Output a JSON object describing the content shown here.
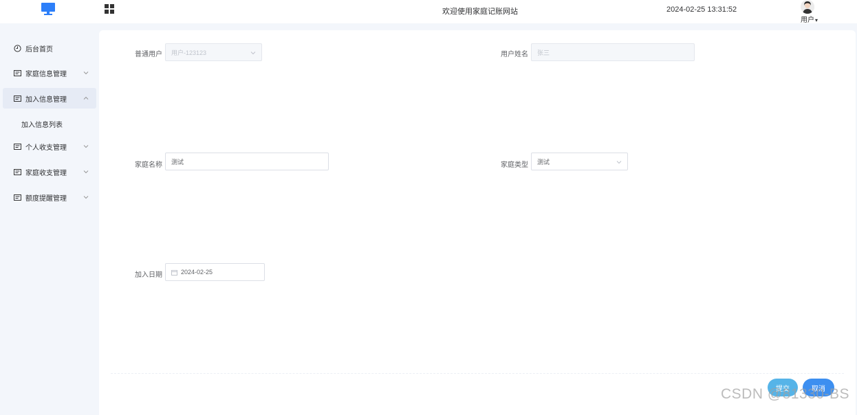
{
  "header": {
    "welcome": "欢迎使用家庭记账网站",
    "datetime": "2024-02-25 13:31:52",
    "user_label": "用户"
  },
  "sidebar": {
    "items": [
      {
        "label": "后台首页",
        "icon": "clock-icon",
        "expandable": false
      },
      {
        "label": "家庭信息管理",
        "icon": "list-icon",
        "expandable": true,
        "expanded": false
      },
      {
        "label": "加入信息管理",
        "icon": "list-icon",
        "expandable": true,
        "expanded": true
      },
      {
        "label": "个人收支管理",
        "icon": "list-icon",
        "expandable": true,
        "expanded": false
      },
      {
        "label": "家庭收支管理",
        "icon": "list-icon",
        "expandable": true,
        "expanded": false
      },
      {
        "label": "额度提醒管理",
        "icon": "list-icon",
        "expandable": true,
        "expanded": false
      }
    ],
    "submenu": {
      "label": "加入信息列表"
    }
  },
  "form": {
    "user": {
      "label": "普通用户",
      "value": "用户-123123",
      "disabled": true
    },
    "user_name": {
      "label": "用户姓名",
      "value": "张三",
      "disabled": true
    },
    "family_name": {
      "label": "家庭名称",
      "value": "测试"
    },
    "family_type": {
      "label": "家庭类型",
      "value": "测试"
    },
    "join_date": {
      "label": "加入日期",
      "value": "2024-02-25"
    }
  },
  "actions": {
    "submit_label": "提交",
    "cancel_label": "取消"
  },
  "watermark": "CSDN @81330-BS",
  "colors": {
    "primary": "#3d8ff0",
    "submit": "#56b4e8",
    "background": "#f3f6fb"
  }
}
